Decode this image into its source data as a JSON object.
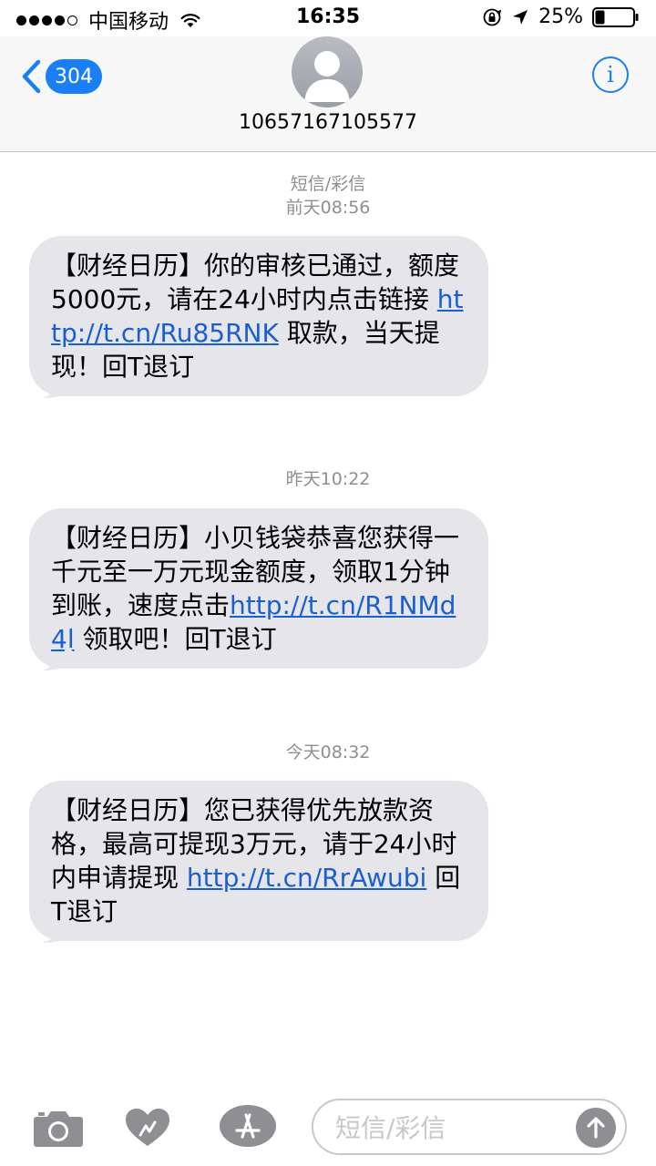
{
  "status_bar": {
    "carrier": "中国移动",
    "time": "16:35",
    "battery": "25%",
    "battery_level": 0.25
  },
  "header": {
    "back_count": "304",
    "contact_number": "10657167105577",
    "info_label": "i"
  },
  "messages": [
    {
      "meta_lines": [
        "短信/彩信",
        "前天08:56"
      ],
      "before": "【财经日历】你的审核已通过，额度 5000元，请在24小时内点击链接 ",
      "link": "http://t.cn/Ru85RNK",
      "after": " 取款，当天提现！回T退订"
    },
    {
      "meta_lines": [
        "昨天10:22"
      ],
      "before": "【财经日历】小贝钱袋恭喜您获得一千元至一万元现金额度，领取1分钟到账，速度点击",
      "link": "http://t.cn/R1NMd4l",
      "after": " 领取吧！回T退订"
    },
    {
      "meta_lines": [
        "今天08:32"
      ],
      "before": "【财经日历】您已获得优先放款资格，最高可提现3万元，请于24小时内申请提现 ",
      "link": "http://t.cn/RrAwubi",
      "after": " 回T退订"
    }
  ],
  "input": {
    "placeholder": "短信/彩信",
    "value": ""
  },
  "colors": {
    "accent": "#1a7ff5",
    "bubble": "#e5e5ea",
    "link": "#1a5fd1",
    "meta_text": "#8e8e93"
  }
}
